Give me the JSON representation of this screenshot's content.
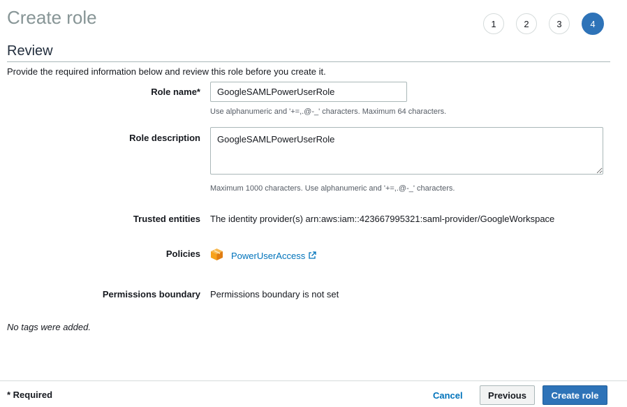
{
  "header": {
    "title": "Create role",
    "steps": [
      "1",
      "2",
      "3",
      "4"
    ],
    "active_step": "4"
  },
  "review": {
    "title": "Review",
    "intro": "Provide the required information below and review this role before you create it."
  },
  "form": {
    "role_name": {
      "label": "Role name*",
      "value": "GoogleSAMLPowerUserRole",
      "hint": "Use alphanumeric and '+=,.@-_' characters. Maximum 64 characters."
    },
    "role_description": {
      "label": "Role description",
      "value": "GoogleSAMLPowerUserRole",
      "hint": "Maximum 1000 characters. Use alphanumeric and '+=,.@-_' characters."
    },
    "trusted_entities": {
      "label": "Trusted entities",
      "value": "The identity provider(s) arn:aws:iam::423667995321:saml-provider/GoogleWorkspace"
    },
    "policies": {
      "label": "Policies",
      "items": [
        {
          "name": "PowerUserAccess",
          "icon": "aws-managed-policy-icon"
        }
      ]
    },
    "permissions_boundary": {
      "label": "Permissions boundary",
      "value": "Permissions boundary is not set"
    }
  },
  "tags_note": "No tags were added.",
  "footer": {
    "required_note": "* Required",
    "cancel_label": "Cancel",
    "previous_label": "Previous",
    "create_label": "Create role"
  },
  "colors": {
    "primary": "#2e73b8",
    "link": "#0073bb",
    "title_gray": "#879596",
    "policy_orange": "#f7a21b"
  }
}
